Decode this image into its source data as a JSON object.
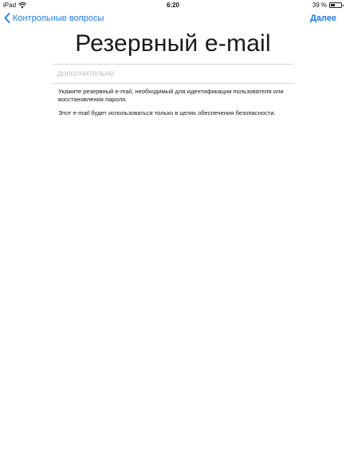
{
  "status_bar": {
    "device": "iPad",
    "time": "6:20",
    "battery_percent_label": "39 %",
    "battery_level": 0.39
  },
  "nav": {
    "back_label": "Контрольные вопросы",
    "next_label": "Далее",
    "accent_color": "#1d7af3"
  },
  "page": {
    "title": "Резервный e-mail"
  },
  "email_field": {
    "value": "",
    "placeholder": "дополнительно"
  },
  "description": {
    "line1": "Укажите резервный e-mail, необходимый для идентификации пользователя или восстановления пароля.",
    "line2": "Этот e-mail будет использоваться только в целях обеспечения безопасности."
  },
  "icons": {
    "wifi": "wifi-icon",
    "battery": "battery-icon",
    "back": "chevron-left-icon"
  }
}
